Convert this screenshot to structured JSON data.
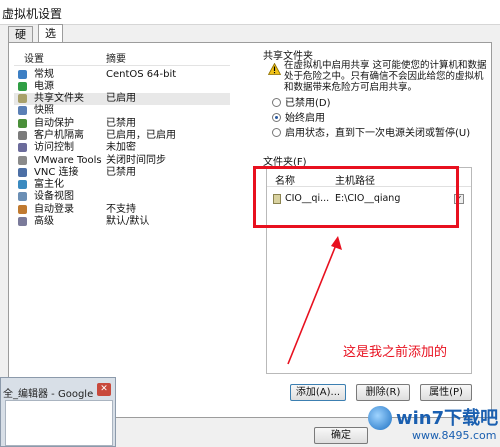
{
  "window": {
    "title": "虚拟机设置"
  },
  "tabs": [
    {
      "label": "硬件"
    },
    {
      "label": "选项"
    }
  ],
  "settings": {
    "col_setting": "设置",
    "col_summary": "摘要",
    "items": [
      {
        "label": "常规",
        "value": "CentOS 64-bit",
        "icon": "general-icon",
        "color": "#3d7fc4"
      },
      {
        "label": "电源",
        "value": "",
        "icon": "power-icon",
        "color": "#2f9e44"
      },
      {
        "label": "共享文件夹",
        "value": "已启用",
        "icon": "shared-folder-icon",
        "color": "#a8a06a"
      },
      {
        "label": "快照",
        "value": "",
        "icon": "snapshot-icon",
        "color": "#5a7fb5"
      },
      {
        "label": "自动保护",
        "value": "已禁用",
        "icon": "autoprotect-icon",
        "color": "#4a8f3a"
      },
      {
        "label": "客户机隔离",
        "value": "已启用，已启用",
        "icon": "isolation-icon",
        "color": "#7b7b7b"
      },
      {
        "label": "访问控制",
        "value": "未加密",
        "icon": "access-control-icon",
        "color": "#6b6b9b"
      },
      {
        "label": "VMware Tools",
        "value": "关闭时间同步",
        "icon": "vmware-tools-icon",
        "color": "#8a8a8a"
      },
      {
        "label": "VNC 连接",
        "value": "已禁用",
        "icon": "vnc-icon",
        "color": "#4c6fa5"
      },
      {
        "label": "富主化",
        "value": "",
        "icon": "unity-icon",
        "color": "#3a8ac0"
      },
      {
        "label": "设备视图",
        "value": "",
        "icon": "device-view-icon",
        "color": "#6b8fb5"
      },
      {
        "label": "自动登录",
        "value": "不支持",
        "icon": "autologin-icon",
        "color": "#c07a30"
      },
      {
        "label": "高级",
        "value": "默认/默认",
        "icon": "advanced-icon",
        "color": "#7a7a9a"
      }
    ]
  },
  "shared": {
    "group_title": "共享文件夹",
    "warning": "在虚拟机中启用共享 这可能使您的计算机和数据处于危险之中。只有确信不会因此给您的虚拟机和数据带来危险方可启用共享。",
    "options": [
      {
        "label": "已禁用(D)",
        "checked": false
      },
      {
        "label": "始终启用",
        "checked": true
      },
      {
        "label": "启用状态，直到下一次电源关闭或暂停(U)",
        "checked": false
      }
    ]
  },
  "folders": {
    "group_title": "文件夹(F)",
    "col_name": "名称",
    "col_path": "主机路径",
    "rows": [
      {
        "name": "CIO__qi...",
        "path": "E:\\CIO__qiang",
        "checked": true
      }
    ],
    "add_label": "添加(A)...",
    "remove_label": "删除(R)",
    "props_label": "属性(P)"
  },
  "annotation": "这是我之前添加的",
  "ok_label": "确定",
  "taskbar_thumb": {
    "title": "全_编辑器 - Google ..."
  },
  "watermark": {
    "text": "win7下载吧",
    "url": "www.8495.com"
  },
  "accent_color": "#e8101f"
}
